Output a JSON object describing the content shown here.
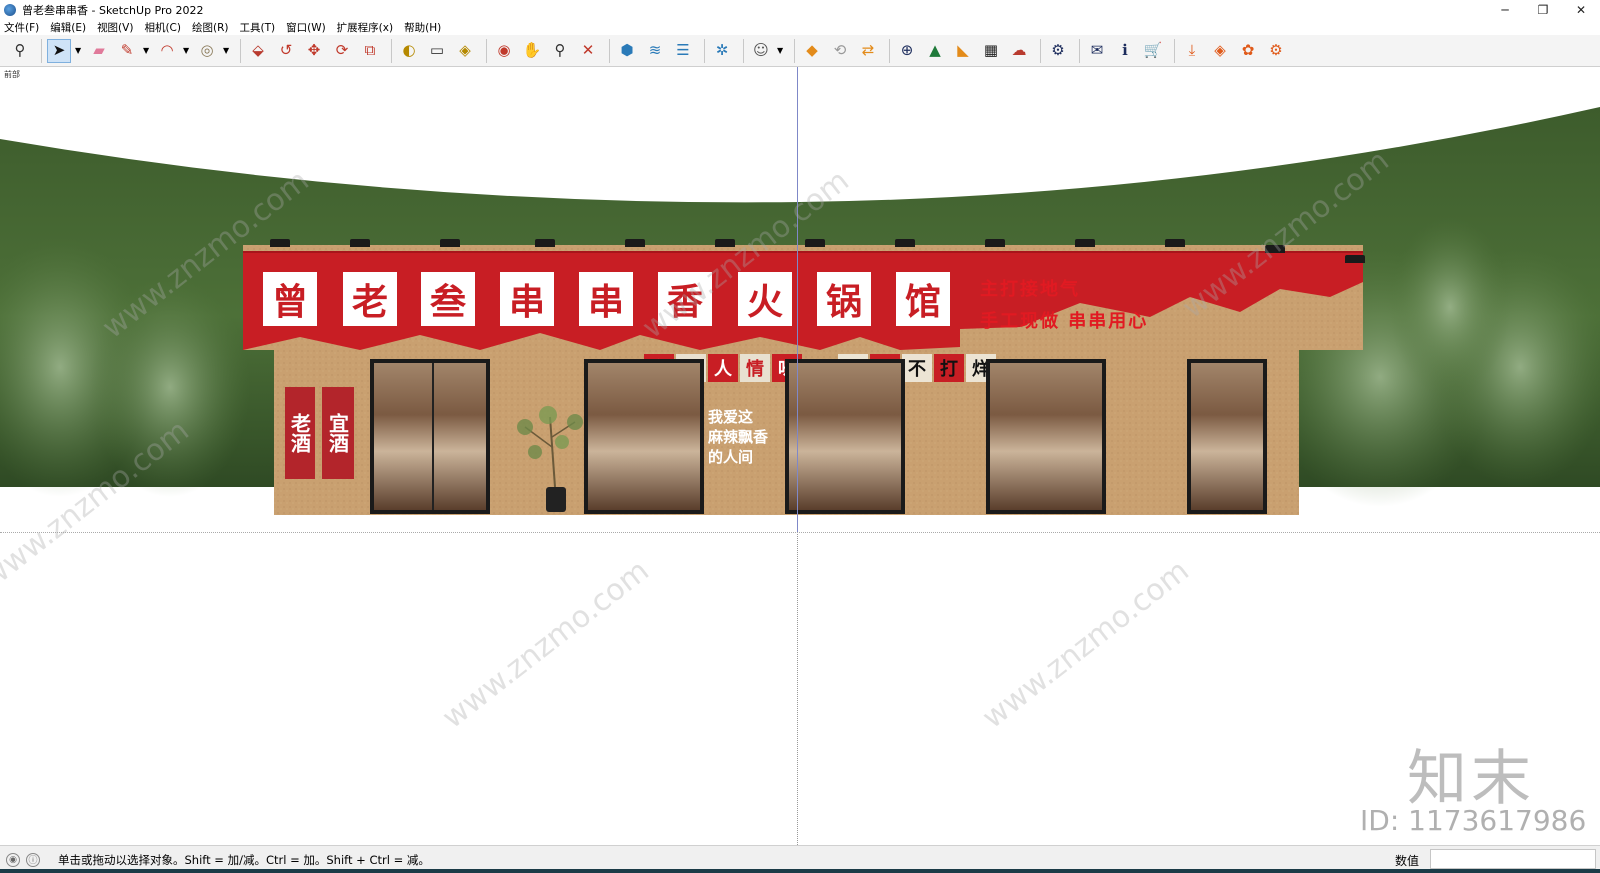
{
  "window": {
    "title": "曾老叁串串香 - SketchUp Pro 2022",
    "minimize": "─",
    "maximize": "❐",
    "close": "✕"
  },
  "menu": [
    "文件(F)",
    "编辑(E)",
    "视图(V)",
    "相机(C)",
    "绘图(R)",
    "工具(T)",
    "窗口(W)",
    "扩展程序(x)",
    "帮助(H)"
  ],
  "scene": {
    "label": "前部",
    "sign_chars": [
      "曾",
      "老",
      "叁",
      "串",
      "串",
      "香",
      "火",
      "锅",
      "馆"
    ],
    "slogan_line1": "主打接地气",
    "slogan_line2": "手工现做 串串用心",
    "mid_left": [
      "市",
      "井",
      "人",
      "情",
      "味"
    ],
    "mid_right": [
      "烟",
      "火",
      "不",
      "打",
      "烊"
    ],
    "board_left": "老酒",
    "board_right": "宜酒",
    "wall_text_l1": "我爱这",
    "wall_text_l2": "麻辣飘香",
    "wall_text_l3": "的人间"
  },
  "watermark": {
    "text": "www.znzmo.com",
    "brand": "知末",
    "id": "ID: 1173617986"
  },
  "status": {
    "hint": "单击或拖动以选择对象。Shift = 加/减。Ctrl = 加。Shift + Ctrl = 减。",
    "vcb_label": "数值",
    "vcb_value": ""
  },
  "colors": {
    "sign_red": "#c81e24",
    "wall_tan": "#c9a070",
    "forest_green": "#3f5f2a"
  }
}
